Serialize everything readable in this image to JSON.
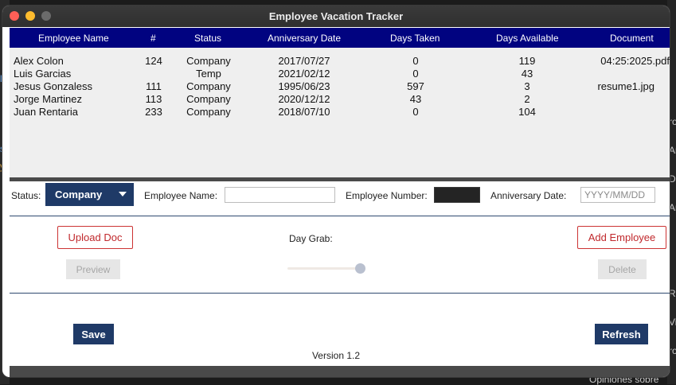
{
  "background": {
    "fragments": [
      "lc",
      "st",
      "yp",
      "ro",
      "Ar",
      "Di",
      "Ar",
      "Re",
      "Vi",
      "ro",
      "Opiniones sobre"
    ]
  },
  "window": {
    "title": "Employee Vacation Tracker"
  },
  "table": {
    "headers": {
      "name": "Employee Name",
      "num": "#",
      "status": "Status",
      "anniversary": "Anniversary Date",
      "taken": "Days Taken",
      "available": "Days Available",
      "document": "Document"
    },
    "rows": [
      {
        "name": "Alex Colon",
        "num": "124",
        "status": "Company",
        "anniversary": "2017/07/27",
        "taken": "0",
        "available": "119",
        "document": "04:25:2025.pdf"
      },
      {
        "name": "Luis Garcias",
        "num": "",
        "status": "Temp",
        "anniversary": "2021/02/12",
        "taken": "0",
        "available": "43",
        "document": ""
      },
      {
        "name": "Jesus Gonzaless",
        "num": "111",
        "status": "Company",
        "anniversary": "1995/06/23",
        "taken": "597",
        "available": "3",
        "document": "resume1.jpg"
      },
      {
        "name": "Jorge Martinez",
        "num": "113",
        "status": "Company",
        "anniversary": "2020/12/12",
        "taken": "43",
        "available": "2",
        "document": ""
      },
      {
        "name": "Juan Rentaria",
        "num": "233",
        "status": "Company",
        "anniversary": "2018/07/10",
        "taken": "0",
        "available": "104",
        "document": ""
      }
    ]
  },
  "form": {
    "status_label": "Status:",
    "status_value": "Company",
    "employee_name_label": "Employee Name:",
    "employee_name_value": "",
    "employee_number_label": "Employee Number:",
    "employee_number_value": "",
    "anniversary_label": "Anniversary Date:",
    "anniversary_placeholder": "YYYY/MM/DD"
  },
  "actions": {
    "upload_doc": "Upload Doc",
    "preview": "Preview",
    "day_grab_label": "Day Grab:",
    "day_grab_value_fraction": 0.97,
    "add_employee": "Add Employee",
    "delete": "Delete",
    "save": "Save",
    "refresh": "Refresh"
  },
  "footer": {
    "version": "Version 1.2"
  },
  "colors": {
    "header_bg": "#010380",
    "accent": "#1f3a67",
    "outline_red": "#c0282c",
    "traffic_red": "#fe5f57",
    "traffic_yellow": "#febc2e"
  }
}
